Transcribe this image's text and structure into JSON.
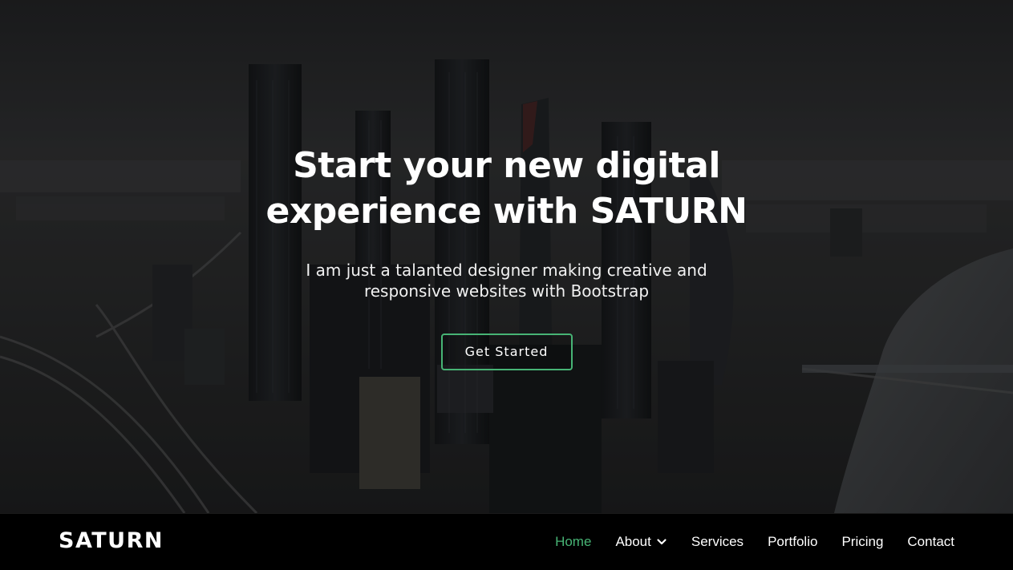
{
  "hero": {
    "title_line1": "Start your new digital",
    "title_line2": "experience with SATURN",
    "subtitle_line1": "I am just a talanted designer making creative and",
    "subtitle_line2": "responsive websites with Bootstrap",
    "cta_label": "Get Started"
  },
  "navbar": {
    "logo": "SATURN",
    "items": [
      {
        "label": "Home",
        "active": true
      },
      {
        "label": "About",
        "has_dropdown": true
      },
      {
        "label": "Services"
      },
      {
        "label": "Portfolio"
      },
      {
        "label": "Pricing"
      },
      {
        "label": "Contact"
      }
    ]
  },
  "colors": {
    "accent": "#47b475",
    "background": "#000000",
    "text": "#ffffff"
  },
  "icons": {
    "dropdown": "chevron-down-icon"
  }
}
